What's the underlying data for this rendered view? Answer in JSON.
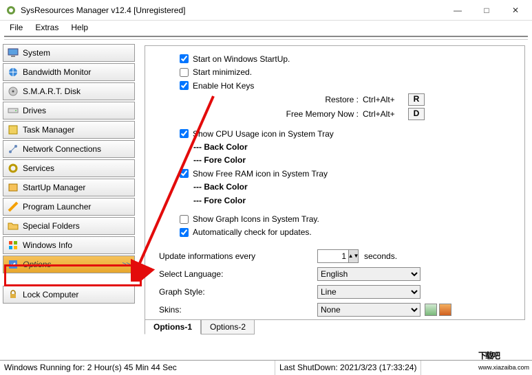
{
  "window": {
    "title": "SysResources Manager  v12.4 [Unregistered]"
  },
  "menu": {
    "file": "File",
    "extras": "Extras",
    "help": "Help"
  },
  "sidebar": {
    "items": [
      {
        "label": "System"
      },
      {
        "label": "Bandwidth Monitor"
      },
      {
        "label": "S.M.A.R.T. Disk"
      },
      {
        "label": "Drives"
      },
      {
        "label": "Task Manager"
      },
      {
        "label": "Network Connections"
      },
      {
        "label": "Services"
      },
      {
        "label": "StartUp Manager"
      },
      {
        "label": "Program Launcher"
      },
      {
        "label": "Special Folders"
      },
      {
        "label": "Windows Info"
      },
      {
        "label": "Options"
      },
      {
        "label": "Lock Computer"
      }
    ]
  },
  "options": {
    "start_on_startup": {
      "label": "Start on Windows StartUp.",
      "checked": true
    },
    "start_minimized": {
      "label": "Start minimized.",
      "checked": false
    },
    "enable_hotkeys": {
      "label": "Enable Hot Keys",
      "checked": true
    },
    "hk_restore": {
      "label": "Restore :",
      "combo": "Ctrl+Alt+",
      "key": "R"
    },
    "hk_freemem": {
      "label": "Free Memory Now :",
      "combo": "Ctrl+Alt+",
      "key": "D"
    },
    "cpu_tray": {
      "label": "Show CPU Usage icon in System Tray",
      "checked": true,
      "back": "--- Back Color",
      "fore": "--- Fore Color"
    },
    "ram_tray": {
      "label": "Show Free RAM icon in System Tray",
      "checked": true,
      "back": "--- Back Color",
      "fore": "--- Fore Color"
    },
    "graph_tray": {
      "label": "Show Graph Icons in System Tray.",
      "checked": false
    },
    "auto_update": {
      "label": "Automatically check for updates.",
      "checked": true
    },
    "update_every": {
      "label": "Update informations every",
      "value": "1",
      "suffix": "seconds."
    },
    "language": {
      "label": "Select Language:",
      "value": "English"
    },
    "graph_style": {
      "label": "Graph Style:",
      "value": "Line"
    },
    "skins": {
      "label": "Skins:",
      "value": "None"
    }
  },
  "tabs": {
    "t1": "Options-1",
    "t2": "Options-2"
  },
  "status": {
    "running": "Windows Running for: 2 Hour(s) 45 Min 44 Sec",
    "shutdown": "Last ShutDown: 2021/3/23 (17:33:24)"
  },
  "watermark": {
    "text": "下载吧",
    "url": "www.xiazaiba.com"
  }
}
